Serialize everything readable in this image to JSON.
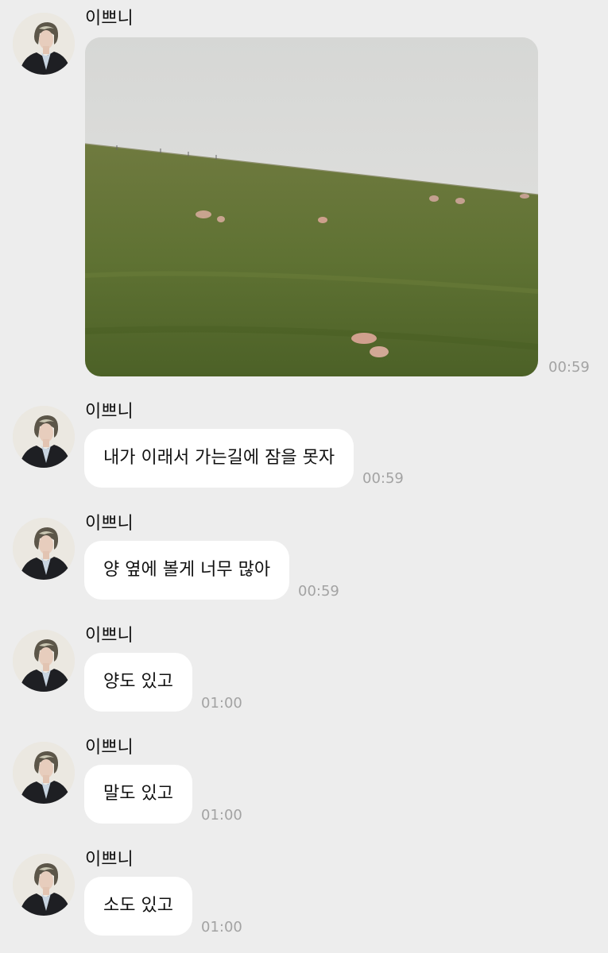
{
  "chat": {
    "messages": [
      {
        "sender": "이쁘니",
        "type": "image",
        "image_content": "sheep grazing on a green hillside under an overcast sky",
        "time": "00:59"
      },
      {
        "sender": "이쁘니",
        "type": "text",
        "text": "내가 이래서 가는길에 잠을 못자",
        "time": "00:59"
      },
      {
        "sender": "이쁘니",
        "type": "text",
        "text": "양 옆에 볼게 너무 많아",
        "time": "00:59"
      },
      {
        "sender": "이쁘니",
        "type": "text",
        "text": "양도 있고",
        "time": "01:00"
      },
      {
        "sender": "이쁘니",
        "type": "text",
        "text": "말도 있고",
        "time": "01:00"
      },
      {
        "sender": "이쁘니",
        "type": "text",
        "text": "소도 있고",
        "time": "01:00"
      }
    ]
  },
  "colors": {
    "background": "#ededed",
    "bubble": "#ffffff",
    "timestamp": "#a3a3a3"
  },
  "icons": {
    "avatar": "profile-photo"
  }
}
